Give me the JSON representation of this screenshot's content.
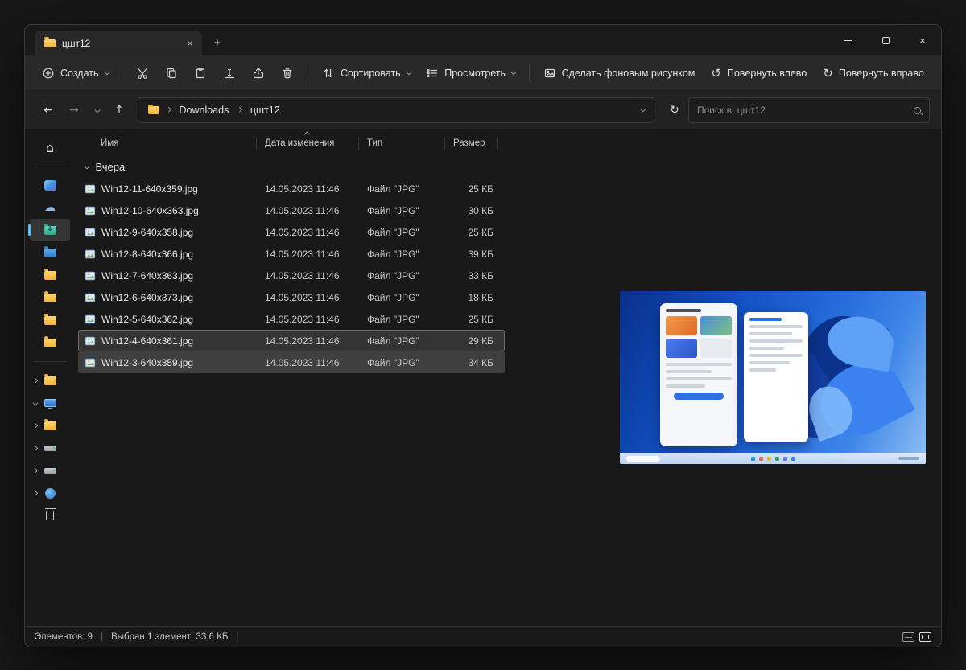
{
  "icons": {
    "back": "←",
    "forward": "→",
    "up": "↑",
    "refresh": "↻",
    "rotate_left": "↺",
    "rotate_right": "↻",
    "more": "⋯",
    "close": "×",
    "new_tab": "+",
    "home": "⌂",
    "cloud": "☁"
  },
  "window": {
    "tab_title": "цшт12"
  },
  "toolbar": {
    "create": "Создать",
    "sort": "Сортировать",
    "view": "Просмотреть",
    "set_wallpaper": "Сделать фоновым рисунком",
    "rotate_left": "Повернуть влево",
    "rotate_right": "Повернуть вправо"
  },
  "navbar": {
    "crumb_root": "Downloads",
    "crumb_current": "цшт12",
    "search_placeholder": "Поиск в: цшт12"
  },
  "sidebar": {
    "items": [
      {
        "id": "home",
        "icon": "home"
      },
      {
        "sep": true
      },
      {
        "id": "gallery",
        "icon": "gallery"
      },
      {
        "id": "onedrive",
        "icon": "cloud"
      },
      {
        "id": "downloads",
        "icon": "downloads",
        "current": true
      },
      {
        "id": "pictures",
        "icon": "pictures"
      },
      {
        "id": "folder-1",
        "icon": "folder"
      },
      {
        "id": "folder-2",
        "icon": "folder"
      },
      {
        "id": "folder-3",
        "icon": "folder"
      },
      {
        "id": "folder-4",
        "icon": "folder"
      },
      {
        "sep": true
      },
      {
        "id": "tree-folder",
        "icon": "folder",
        "chev": "right"
      },
      {
        "id": "this-pc",
        "icon": "monitor",
        "chev": "down"
      },
      {
        "id": "tree-1",
        "icon": "folder",
        "chev": "right"
      },
      {
        "id": "drive-1",
        "icon": "drive",
        "chev": "right"
      },
      {
        "id": "drive-2",
        "icon": "drive",
        "chev": "right"
      },
      {
        "id": "network",
        "icon": "net",
        "chev": "right"
      },
      {
        "id": "recycle-bin",
        "icon": "bin"
      }
    ]
  },
  "filelist": {
    "columns": {
      "name": "Имя",
      "date": "Дата изменения",
      "type": "Тип",
      "size": "Размер"
    },
    "group_label": "Вчера",
    "rows": [
      {
        "name": "Win12-11-640x359.jpg",
        "date": "14.05.2023 11:46",
        "type": "Файл \"JPG\"",
        "size": "25 КБ"
      },
      {
        "name": "Win12-10-640x363.jpg",
        "date": "14.05.2023 11:46",
        "type": "Файл \"JPG\"",
        "size": "30 КБ"
      },
      {
        "name": "Win12-9-640x358.jpg",
        "date": "14.05.2023 11:46",
        "type": "Файл \"JPG\"",
        "size": "25 КБ"
      },
      {
        "name": "Win12-8-640x366.jpg",
        "date": "14.05.2023 11:46",
        "type": "Файл \"JPG\"",
        "size": "39 КБ"
      },
      {
        "name": "Win12-7-640x363.jpg",
        "date": "14.05.2023 11:46",
        "type": "Файл \"JPG\"",
        "size": "33 КБ"
      },
      {
        "name": "Win12-6-640x373.jpg",
        "date": "14.05.2023 11:46",
        "type": "Файл \"JPG\"",
        "size": "18 КБ"
      },
      {
        "name": "Win12-5-640x362.jpg",
        "date": "14.05.2023 11:46",
        "type": "Файл \"JPG\"",
        "size": "25 КБ"
      },
      {
        "name": "Win12-4-640x361.jpg",
        "date": "14.05.2023 11:46",
        "type": "Файл \"JPG\"",
        "size": "29 КБ",
        "state": "hover"
      },
      {
        "name": "Win12-3-640x359.jpg",
        "date": "14.05.2023 11:46",
        "type": "Файл \"JPG\"",
        "size": "34 КБ",
        "state": "selected"
      }
    ]
  },
  "statusbar": {
    "count": "Элементов: 9",
    "selection": "Выбран 1 элемент: 33,6 КБ",
    "divider": "|"
  }
}
